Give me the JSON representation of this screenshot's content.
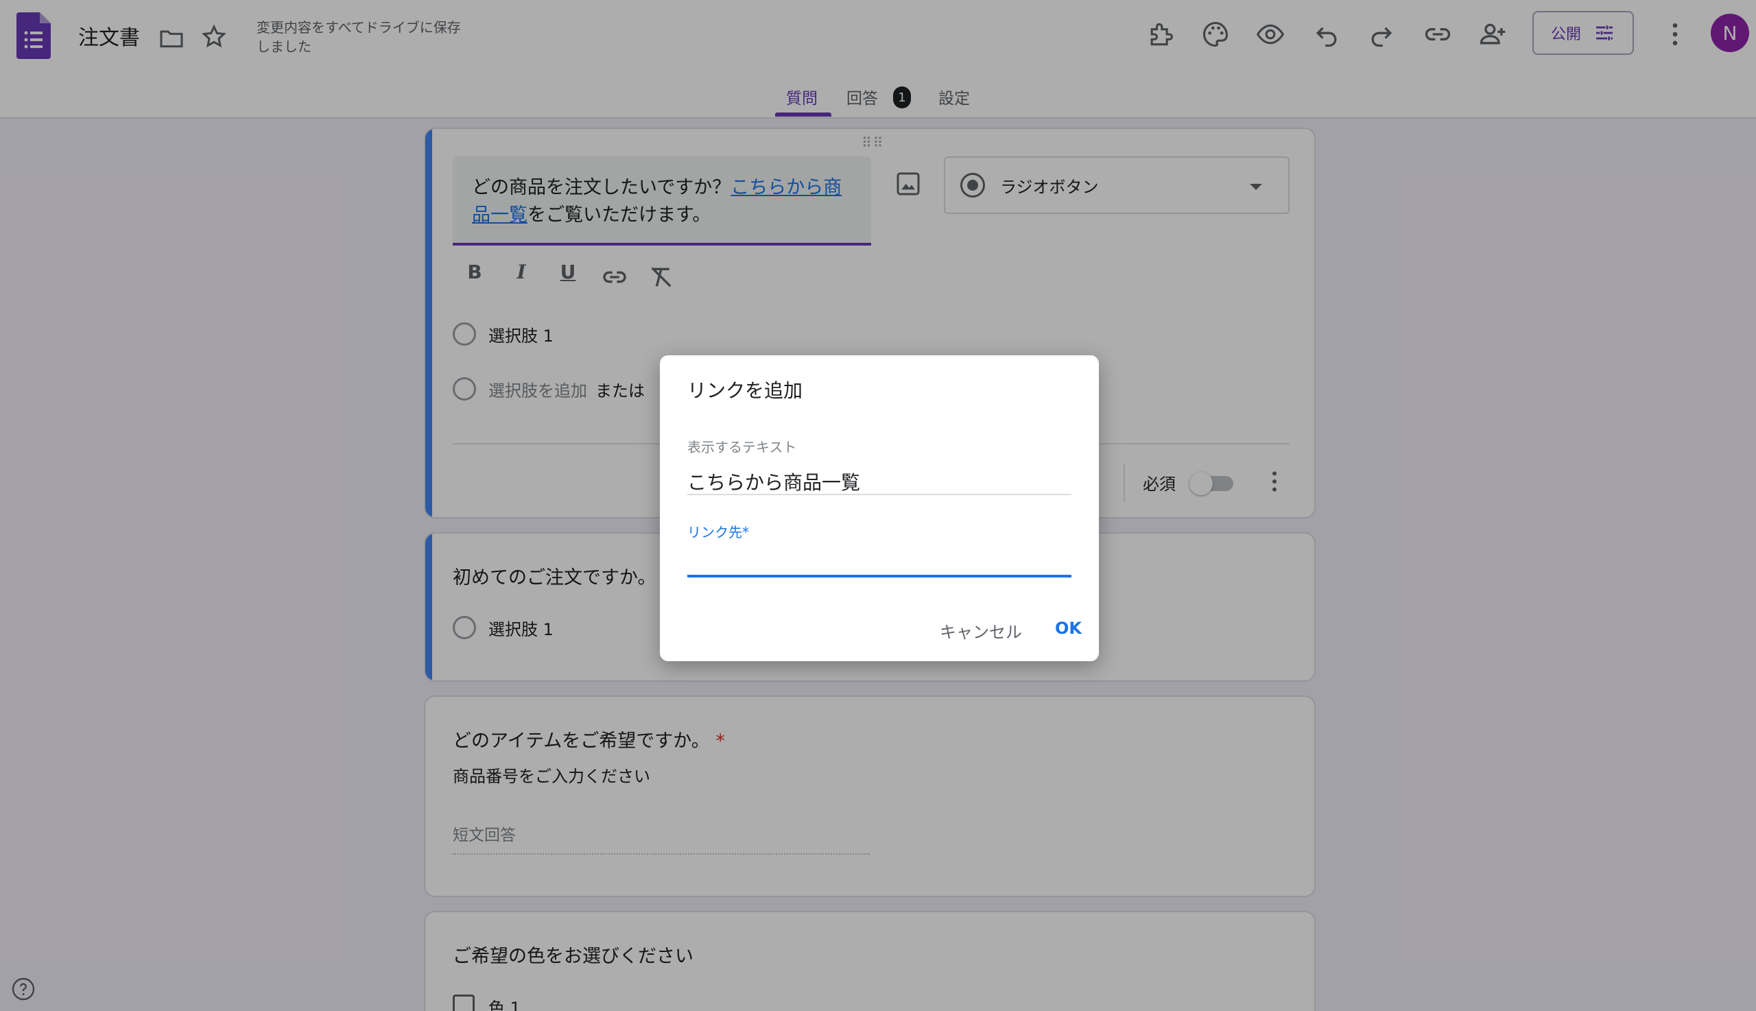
{
  "header": {
    "doc_title": "注文書",
    "save_status": "変更内容をすべてドライブに保存しました",
    "publish_label": "公開",
    "avatar_initial": "N"
  },
  "tabs": {
    "questions": "質問",
    "responses": "回答",
    "responses_count": "1",
    "settings": "設定"
  },
  "q1": {
    "text_before": "どの商品を注文したいですか？",
    "link_text": "こちらから商品一覧",
    "text_after": "をご覧いただけます。",
    "type_label": "ラジオボタン",
    "option1": "選択肢 1",
    "add_option": "選択肢を追加",
    "or_label": "または",
    "required_label": "必須"
  },
  "q2": {
    "title": "初めてのご注文ですか。",
    "option1": "選択肢 1"
  },
  "q3": {
    "title": "どのアイテムをご希望ですか。",
    "required_mark": "*",
    "description": "商品番号をご入力ください",
    "answer_placeholder": "短文回答"
  },
  "q4": {
    "title": "ご希望の色をお選びください",
    "option1": "色 1"
  },
  "dialog": {
    "title": "リンクを追加",
    "display_text_label": "表示するテキスト",
    "display_text_value": "こちらから商品一覧",
    "link_label": "リンク先*",
    "link_value": "",
    "cancel_label": "キャンセル",
    "ok_label": "OK"
  },
  "colors": {
    "accent": "#673ab7",
    "active_card": "#4285f4",
    "link": "#1a73e8"
  }
}
